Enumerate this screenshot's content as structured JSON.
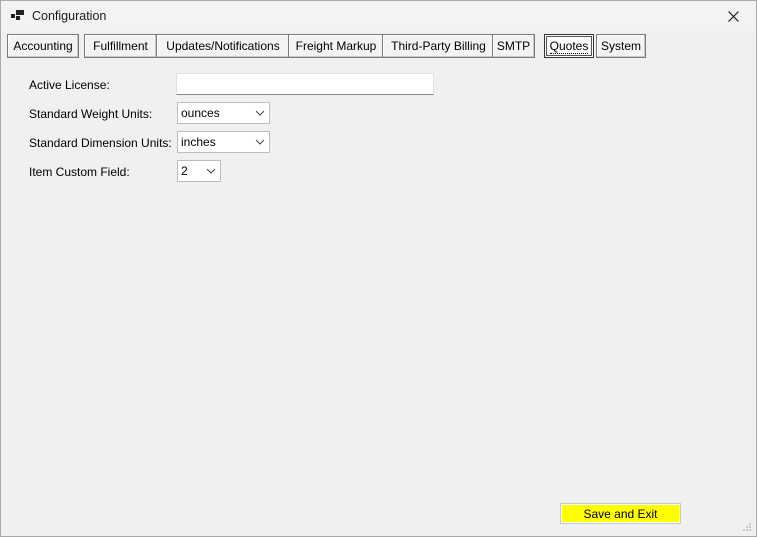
{
  "window": {
    "title": "Configuration",
    "icon": "app-window-icon"
  },
  "tabs": [
    {
      "label": "Accounting",
      "active": false
    },
    {
      "label": "Fulfillment",
      "active": false
    },
    {
      "label": "Updates/Notifications",
      "active": false
    },
    {
      "label": "Freight Markup",
      "active": false
    },
    {
      "label": "Third-Party Billing",
      "active": false
    },
    {
      "label": "SMTP",
      "active": false
    },
    {
      "label": "Quotes",
      "active": true
    },
    {
      "label": "System",
      "active": false
    }
  ],
  "form": {
    "active_license": {
      "label": "Active License:",
      "value": ""
    },
    "weight_units": {
      "label": "Standard Weight Units:",
      "value": "ounces"
    },
    "dimension_units": {
      "label": "Standard Dimension Units:",
      "value": "inches"
    },
    "custom_field": {
      "label": "Item Custom Field:",
      "value": "2"
    }
  },
  "footer": {
    "save_label": "Save and Exit",
    "save_color": "#ffff00"
  }
}
